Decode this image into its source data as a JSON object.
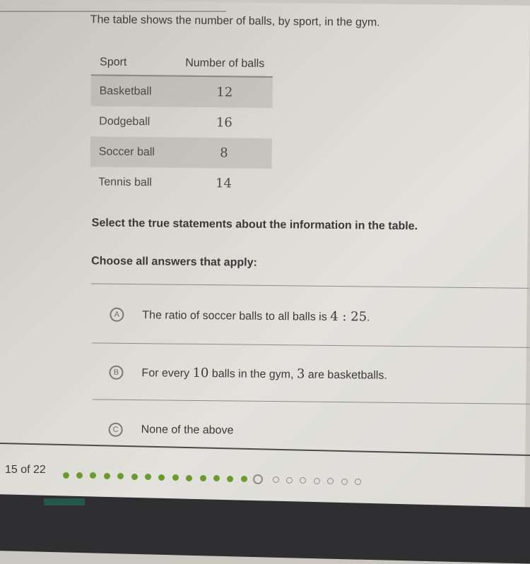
{
  "question": {
    "intro": "The table shows the number of balls, by sport, in the gym.",
    "table": {
      "headers": [
        "Sport",
        "Number of balls"
      ],
      "rows": [
        {
          "sport": "Basketball",
          "count": "12"
        },
        {
          "sport": "Dodgeball",
          "count": "16"
        },
        {
          "sport": "Soccer ball",
          "count": "8"
        },
        {
          "sport": "Tennis ball",
          "count": "14"
        }
      ]
    },
    "prompt": "Select the true statements about the information in the table.",
    "instruction": "Choose all answers that apply:",
    "choices": [
      {
        "letter": "A",
        "text_before": "The ratio of soccer balls to all balls is ",
        "math": "4 : 25",
        "text_after": ".",
        "selected": false
      },
      {
        "letter": "B",
        "text_before": "For every ",
        "math": "10",
        "text_mid": " balls in the gym, ",
        "math2": "3",
        "text_after": " are basketballs.",
        "selected": false
      },
      {
        "letter": "C",
        "text_before": "None of the above",
        "selected": false
      }
    ]
  },
  "progress": {
    "label": "15 of 22",
    "current": 15,
    "total": 22,
    "completed": 14
  },
  "colors": {
    "completed_dot": "#6a9b2c",
    "pending_dot": "#8d8b86"
  }
}
